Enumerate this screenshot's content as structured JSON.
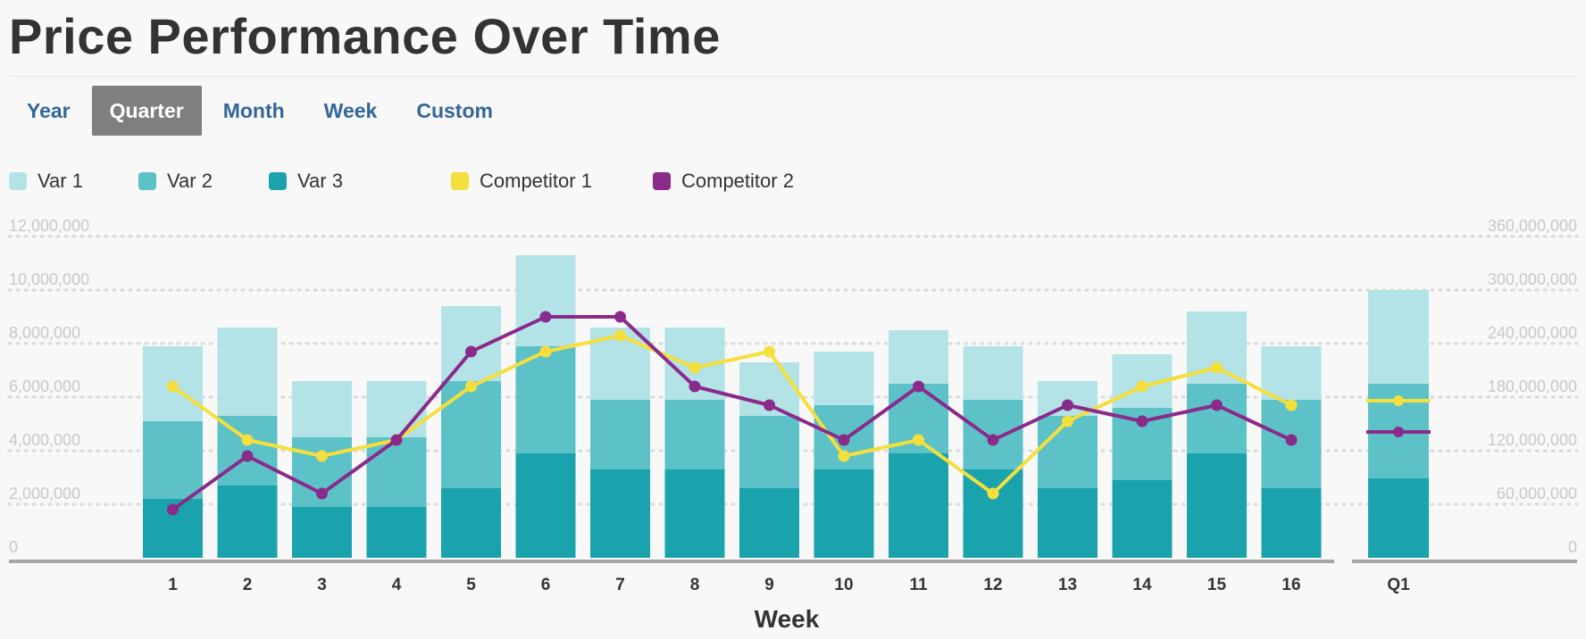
{
  "title": "Price Performance Over Time",
  "tabs": [
    {
      "label": "Year",
      "active": false
    },
    {
      "label": "Quarter",
      "active": true
    },
    {
      "label": "Month",
      "active": false
    },
    {
      "label": "Week",
      "active": false
    },
    {
      "label": "Custom",
      "active": false
    }
  ],
  "colors": {
    "var1": "#b3e3e6",
    "var2": "#5cc2c8",
    "var3": "#1aa3ad",
    "competitor1": "#f5df3c",
    "competitor2": "#8a2a8a",
    "tab_text": "#336699",
    "tab_active_bg": "#7f7f7f",
    "axis_text": "#c8c8c8"
  },
  "chart_data": {
    "type": "bar",
    "stacked": true,
    "categories": [
      "1",
      "2",
      "3",
      "4",
      "5",
      "6",
      "7",
      "8",
      "9",
      "10",
      "11",
      "12",
      "13",
      "14",
      "15",
      "16"
    ],
    "summary_category": "Q1",
    "xlabel": "Week",
    "y_left": {
      "ticks": [
        "0",
        "2,000,000",
        "4,000,000",
        "6,000,000",
        "8,000,000",
        "10,000,000",
        "12,000,000"
      ],
      "lim": [
        0,
        12000000
      ]
    },
    "y_right": {
      "ticks": [
        "0",
        "60,000,000",
        "120,000,000",
        "180,000,000",
        "240,000,000",
        "300,000,000",
        "360,000,000"
      ],
      "lim": [
        0,
        360000000
      ]
    },
    "grid": "dotted horizontal",
    "legend_position": "top-left",
    "series": [
      {
        "name": "Var 3",
        "kind": "bar",
        "values": [
          2200000,
          2700000,
          1900000,
          1900000,
          2600000,
          3900000,
          3300000,
          3300000,
          2600000,
          3300000,
          3900000,
          3300000,
          2600000,
          2900000,
          3900000,
          2600000
        ]
      },
      {
        "name": "Var 2",
        "kind": "bar",
        "values": [
          2900000,
          2600000,
          2600000,
          2600000,
          4000000,
          4000000,
          2600000,
          2600000,
          2700000,
          2400000,
          2600000,
          2600000,
          2700000,
          2700000,
          2600000,
          3300000
        ]
      },
      {
        "name": "Var 1",
        "kind": "bar",
        "values": [
          2800000,
          3300000,
          2100000,
          2100000,
          2800000,
          3400000,
          2700000,
          2700000,
          2000000,
          2000000,
          2000000,
          2000000,
          1300000,
          2000000,
          2700000,
          2000000
        ]
      },
      {
        "name": "Competitor 1",
        "kind": "line",
        "values": [
          6400000,
          4400000,
          3800000,
          4400000,
          6400000,
          7700000,
          8300000,
          7100000,
          7700000,
          3800000,
          4400000,
          2400000,
          5100000,
          6400000,
          7100000,
          5700000
        ]
      },
      {
        "name": "Competitor 2",
        "kind": "line",
        "values": [
          1800000,
          3800000,
          2400000,
          4400000,
          7700000,
          9000000,
          9000000,
          6400000,
          5700000,
          4400000,
          6400000,
          4400000,
          5700000,
          5100000,
          5700000,
          4400000
        ]
      }
    ],
    "summary": {
      "axis": "right",
      "bars": {
        "Var 3": 89000000,
        "Var 2": 106000000,
        "Var 1": 105000000
      },
      "Competitor 1": 176000000,
      "Competitor 2": 141000000
    }
  }
}
